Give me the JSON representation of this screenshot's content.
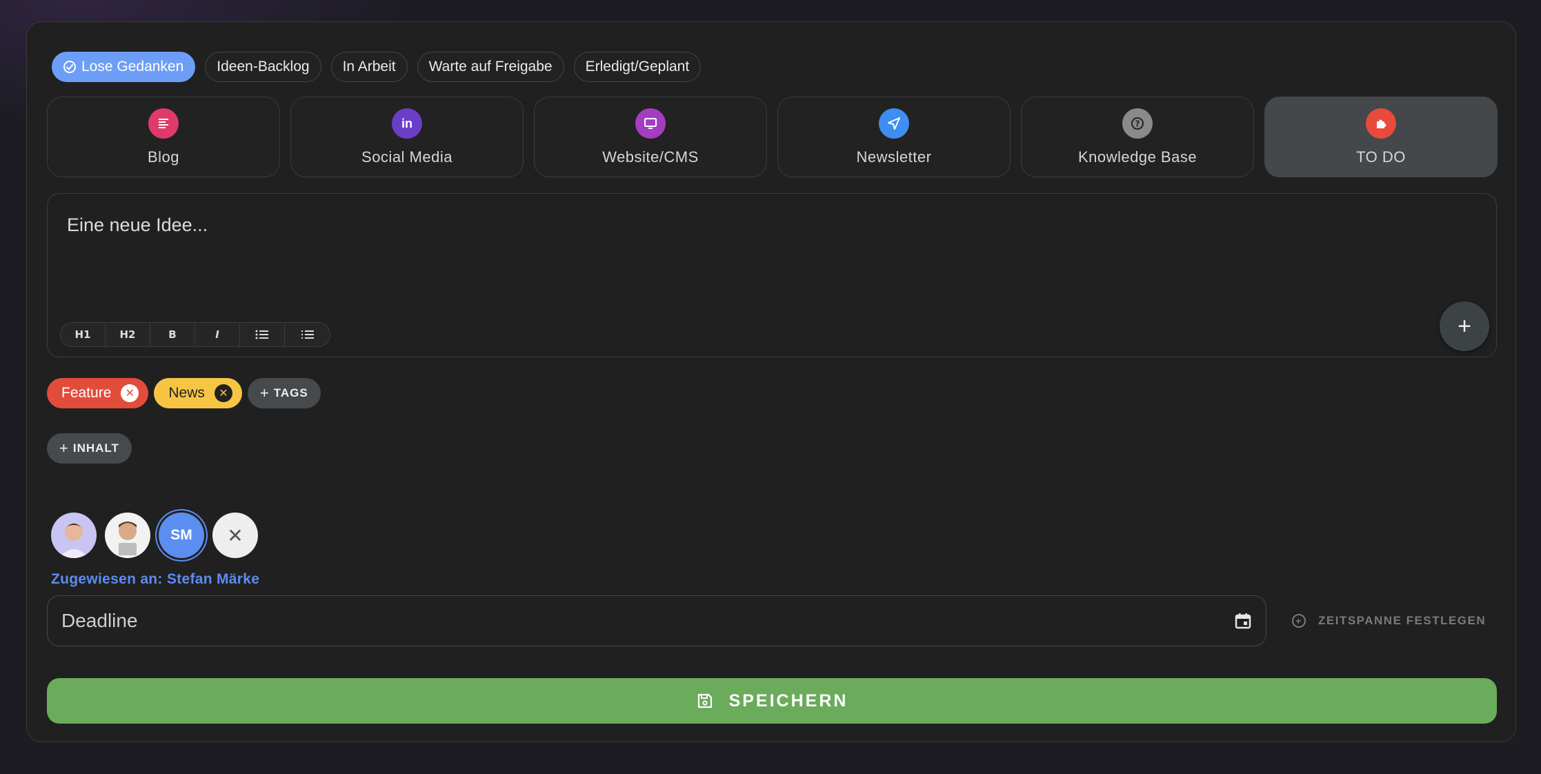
{
  "status_tabs": [
    {
      "label": "Lose Gedanken",
      "active": true
    },
    {
      "label": "Ideen-Backlog",
      "active": false
    },
    {
      "label": "In Arbeit",
      "active": false
    },
    {
      "label": "Warte auf Freigabe",
      "active": false
    },
    {
      "label": "Erledigt/Geplant",
      "active": false
    }
  ],
  "channels": [
    {
      "label": "Blog",
      "icon": "article-icon",
      "color": "#e03a6b"
    },
    {
      "label": "Social Media",
      "icon": "linkedin-icon",
      "color": "#6a3fc8"
    },
    {
      "label": "Website/CMS",
      "icon": "monitor-icon",
      "color": "#a43ec0"
    },
    {
      "label": "Newsletter",
      "icon": "send-icon",
      "color": "#3d8ef0"
    },
    {
      "label": "Knowledge Base",
      "icon": "help-circle-icon",
      "color": "#8a8a8a"
    },
    {
      "label": "TO DO",
      "icon": "puzzle-icon",
      "color": "#e84a3c",
      "active": true
    }
  ],
  "editor": {
    "placeholder": "Eine neue Idee...",
    "toolbar": [
      "H1",
      "H2",
      "B",
      "I",
      "bullet-list",
      "numbered-list"
    ]
  },
  "tags": [
    {
      "label": "Feature",
      "color": "#e24c3b"
    },
    {
      "label": "News",
      "color": "#f6c544"
    }
  ],
  "add_tags_label": "TAGS",
  "add_content_label": "INHALT",
  "assignees": [
    {
      "initials": "",
      "type": "photo"
    },
    {
      "initials": "",
      "type": "photo"
    },
    {
      "initials": "SM",
      "type": "initials",
      "selected": true
    }
  ],
  "assigned_text": "Zugewiesen an: Stefan Märke",
  "deadline_placeholder": "Deadline",
  "timespan_label": "ZEITSPANNE FESTLEGEN",
  "save_label": "SPEICHERN",
  "colors": {
    "accent": "#6d9ef7",
    "save": "#6aac5b"
  }
}
